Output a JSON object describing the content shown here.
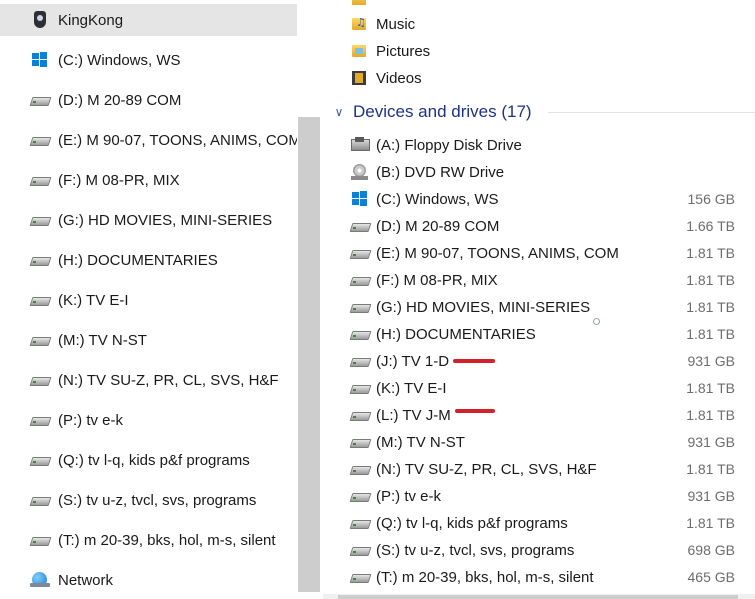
{
  "navigation": {
    "selected": "KingKong",
    "items": [
      {
        "label": "KingKong",
        "icon": "user-folder-icon"
      },
      {
        "label": "(C:) Windows, WS",
        "icon": "windows-drive-icon"
      },
      {
        "label": "(D:) M 20-89 COM",
        "icon": "drive-icon"
      },
      {
        "label": "(E:) M 90-07, TOONS, ANIMS, COM",
        "icon": "drive-icon"
      },
      {
        "label": "(F:) M 08-PR, MIX",
        "icon": "drive-icon"
      },
      {
        "label": "(G:) HD MOVIES, MINI-SERIES",
        "icon": "drive-icon"
      },
      {
        "label": "(H:) DOCUMENTARIES",
        "icon": "drive-icon"
      },
      {
        "label": "(K:) TV E-I",
        "icon": "drive-icon"
      },
      {
        "label": "(M:) TV N-ST",
        "icon": "drive-icon"
      },
      {
        "label": "(N:) TV SU-Z, PR, CL, SVS, H&F",
        "icon": "drive-icon"
      },
      {
        "label": "(P:) tv e-k",
        "icon": "drive-icon"
      },
      {
        "label": "(Q:) tv l-q, kids p&f programs",
        "icon": "drive-icon"
      },
      {
        "label": "(S:) tv u-z, tvcl, svs, programs",
        "icon": "drive-icon"
      },
      {
        "label": "(T:) m 20-39, bks, hol, m-s, silent",
        "icon": "drive-icon"
      },
      {
        "label": "Network",
        "icon": "network-icon"
      }
    ]
  },
  "folders": [
    {
      "label": "Music",
      "icon": "music-folder-icon"
    },
    {
      "label": "Pictures",
      "icon": "pictures-folder-icon"
    },
    {
      "label": "Videos",
      "icon": "videos-folder-icon"
    }
  ],
  "group": {
    "chevron": "∨",
    "title": "Devices and drives (17)"
  },
  "drives": [
    {
      "label": "(A:) Floppy Disk Drive",
      "size": "",
      "icon": "floppy-icon"
    },
    {
      "label": "(B:) DVD RW Drive",
      "size": "",
      "icon": "dvd-icon"
    },
    {
      "label": "(C:) Windows, WS",
      "size": "156 GB",
      "icon": "windows-drive-icon"
    },
    {
      "label": "(D:) M 20-89 COM",
      "size": "1.66 TB",
      "icon": "drive-icon"
    },
    {
      "label": "(E:) M 90-07, TOONS, ANIMS, COM",
      "size": "1.81 TB",
      "icon": "drive-icon"
    },
    {
      "label": "(F:) M 08-PR, MIX",
      "size": "1.81 TB",
      "icon": "drive-icon"
    },
    {
      "label": "(G:) HD MOVIES, MINI-SERIES",
      "size": "1.81 TB",
      "icon": "drive-icon"
    },
    {
      "label": "(H:) DOCUMENTARIES",
      "size": "1.81 TB",
      "icon": "drive-icon"
    },
    {
      "label": "(J:) TV 1-D",
      "size": "931 GB",
      "icon": "drive-icon"
    },
    {
      "label": "(K:) TV E-I",
      "size": "1.81 TB",
      "icon": "drive-icon"
    },
    {
      "label": "(L:) TV J-M",
      "size": "1.81 TB",
      "icon": "drive-icon"
    },
    {
      "label": "(M:) TV N-ST",
      "size": "931 GB",
      "icon": "drive-icon"
    },
    {
      "label": "(N:) TV SU-Z, PR, CL, SVS, H&F",
      "size": "1.81 TB",
      "icon": "drive-icon"
    },
    {
      "label": "(P:) tv e-k",
      "size": "931 GB",
      "icon": "drive-icon"
    },
    {
      "label": "(Q:) tv l-q, kids p&f programs",
      "size": "1.81 TB",
      "icon": "drive-icon"
    },
    {
      "label": "(S:) tv u-z, tvcl, svs, programs",
      "size": "698 GB",
      "icon": "drive-icon"
    },
    {
      "label": "(T:) m 20-39, bks, hol, m-s, silent",
      "size": "465 GB",
      "icon": "drive-icon"
    }
  ],
  "colors": {
    "group_header": "#1e3287",
    "annotation": "#d4202a",
    "selection": "#e5e5e5",
    "size_text": "#6d6d6d"
  }
}
